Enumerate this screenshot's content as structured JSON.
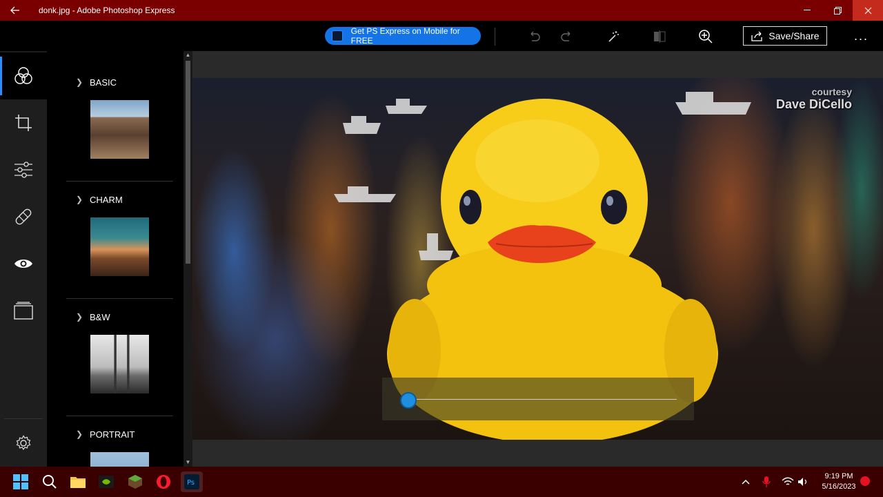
{
  "window": {
    "title": "donk.jpg - Adobe Photoshop Express",
    "back_icon": "arrow-left-icon",
    "controls": [
      "minimize",
      "restore",
      "close"
    ]
  },
  "toolbar": {
    "promo_label": "Get PS Express on Mobile for FREE",
    "icons": [
      "undo-icon",
      "redo-icon",
      "magic-wand-icon",
      "compare-icon",
      "zoom-in-icon"
    ],
    "share_label": "Save/Share",
    "more_label": "..."
  },
  "leftnav": {
    "items": [
      {
        "name": "looks",
        "icon": "looks-circles-icon",
        "active": true
      },
      {
        "name": "crop",
        "icon": "crop-icon",
        "active": false
      },
      {
        "name": "adjustments",
        "icon": "sliders-icon",
        "active": false
      },
      {
        "name": "healing",
        "icon": "bandage-icon",
        "active": false
      },
      {
        "name": "red-eye",
        "icon": "eye-icon",
        "active": false
      },
      {
        "name": "borders",
        "icon": "borders-icon",
        "active": false
      }
    ],
    "settings_icon": "gear-icon"
  },
  "panel": {
    "sections": [
      {
        "label": "BASIC"
      },
      {
        "label": "CHARM"
      },
      {
        "label": "B&W"
      },
      {
        "label": "PORTRAIT"
      }
    ]
  },
  "photo": {
    "watermark_line1": "courtesy",
    "watermark_line2": "Dave DiCello",
    "slider_value": 0
  },
  "taskbar": {
    "apps": [
      "windows-start-icon",
      "search-icon",
      "file-explorer-icon",
      "nvidia-icon",
      "minecraft-icon",
      "opera-icon",
      "photoshop-express-icon"
    ],
    "tray_icons": [
      "chevron-up-icon",
      "microphone-icon",
      "wifi-icon",
      "volume-icon"
    ],
    "time": "9:19 PM",
    "date": "5/16/2023"
  },
  "colors": {
    "titlebar": "#7a0000",
    "accent": "#1473e6",
    "taskbar": "#3a0000"
  }
}
